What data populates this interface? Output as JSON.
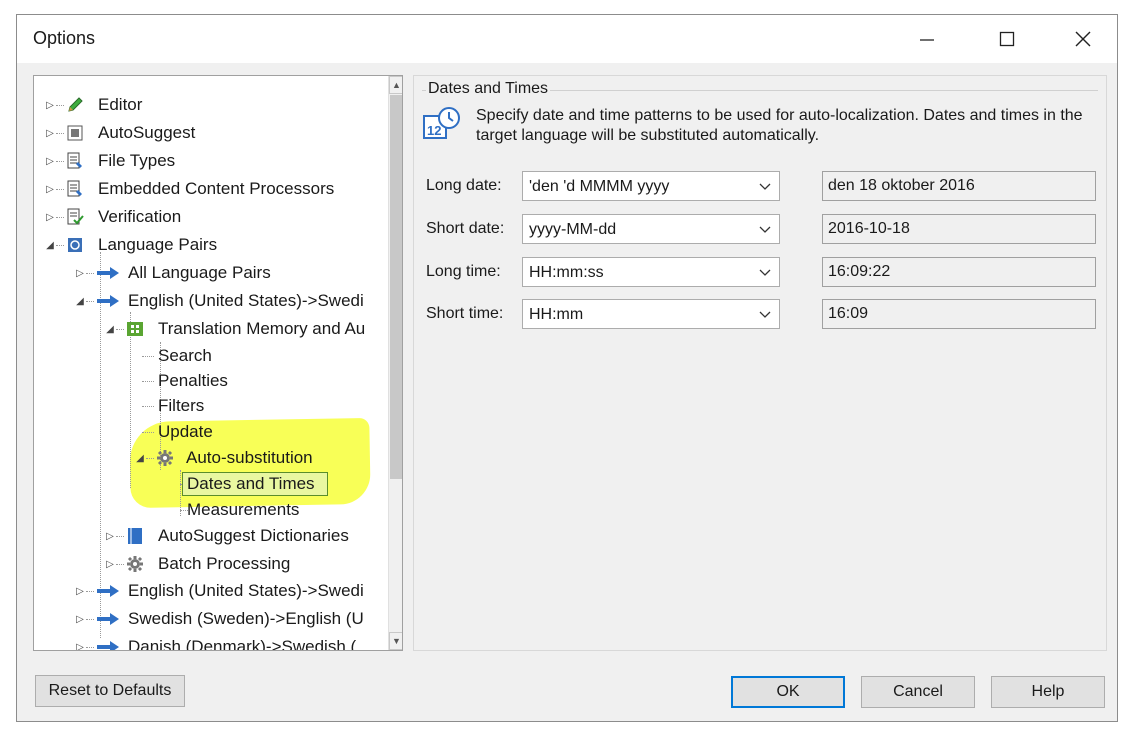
{
  "window": {
    "title": "Options"
  },
  "tree": {
    "items": [
      {
        "label": "Editor",
        "icon": "pencil-icon"
      },
      {
        "label": "AutoSuggest",
        "icon": "autosuggest-icon"
      },
      {
        "label": "File Types",
        "icon": "file-types-icon"
      },
      {
        "label": "Embedded Content Processors",
        "icon": "file-types-icon"
      },
      {
        "label": "Verification",
        "icon": "verification-icon"
      },
      {
        "label": "Language Pairs",
        "icon": "language-pairs-icon"
      },
      {
        "label": "All Language Pairs",
        "icon": "arrow-right-icon"
      },
      {
        "label": "English (United States)->Swedi",
        "icon": "arrow-right-icon"
      },
      {
        "label": "Translation Memory and Au",
        "icon": "translation-memory-icon"
      },
      {
        "label": "Search"
      },
      {
        "label": "Penalties"
      },
      {
        "label": "Filters"
      },
      {
        "label": "Update"
      },
      {
        "label": "Auto-substitution",
        "icon": "gear-icon"
      },
      {
        "label": "Dates and Times"
      },
      {
        "label": "Measurements"
      },
      {
        "label": "AutoSuggest Dictionaries",
        "icon": "dictionary-icon"
      },
      {
        "label": "Batch Processing",
        "icon": "gear-icon"
      },
      {
        "label": "English (United States)->Swedi",
        "icon": "arrow-right-icon"
      },
      {
        "label": "Swedish (Sweden)->English (U",
        "icon": "arrow-right-icon"
      },
      {
        "label": "Danish (Denmark)->Swedish (",
        "icon": "arrow-right-icon"
      }
    ]
  },
  "panel": {
    "group_title": "Dates and Times",
    "description": "Specify date and time patterns to be used for auto-localization. Dates and times in the target language will be substituted automatically.",
    "rows": [
      {
        "label": "Long date:",
        "pattern": "'den 'd MMMM yyyy",
        "preview": "den 18 oktober 2016"
      },
      {
        "label": "Short date:",
        "pattern": "yyyy-MM-dd",
        "preview": "2016-10-18"
      },
      {
        "label": "Long time:",
        "pattern": "HH:mm:ss",
        "preview": "16:09:22"
      },
      {
        "label": "Short time:",
        "pattern": "HH:mm",
        "preview": "16:09"
      }
    ]
  },
  "buttons": {
    "reset": "Reset to Defaults",
    "ok": "OK",
    "cancel": "Cancel",
    "help": "Help"
  },
  "colors": {
    "accent": "#0078d7",
    "highlight": "#f7ff3a",
    "arrow": "#2f6fc4"
  }
}
